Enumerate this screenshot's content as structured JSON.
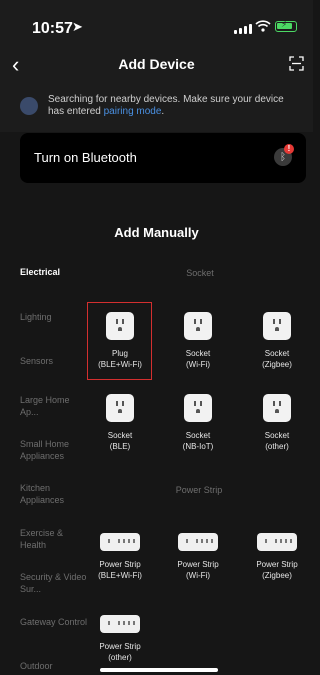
{
  "status_bar": {
    "time": "10:57",
    "location_icon": "location-arrow-icon",
    "signal_icon": "cellular-signal-icon",
    "wifi_icon": "wifi-icon",
    "battery_icon": "battery-charging-icon"
  },
  "nav": {
    "title": "Add Device",
    "back_icon": "chevron-left-icon",
    "scan_icon": "scan-icon"
  },
  "search": {
    "text_before": "Searching for nearby devices. Make sure your device has entered ",
    "link": "pairing mode",
    "text_after": "."
  },
  "bluetooth": {
    "label": "Turn on Bluetooth",
    "badge": "!"
  },
  "section_title": "Add Manually",
  "sidebar": {
    "items": [
      {
        "label": "Electrical",
        "active": true
      },
      {
        "label": "Lighting",
        "active": false
      },
      {
        "label": "Sensors",
        "active": false
      },
      {
        "label": "Large Home Ap...",
        "active": false
      },
      {
        "label": "Small Home Appliances",
        "active": false
      },
      {
        "label": "Kitchen Appliances",
        "active": false
      },
      {
        "label": "Exercise & Health",
        "active": false
      },
      {
        "label": "Security & Video Sur...",
        "active": false
      },
      {
        "label": "Gateway Control",
        "active": false
      },
      {
        "label": "Outdoor",
        "active": false
      }
    ]
  },
  "groups": [
    {
      "label": "Socket",
      "devices": [
        {
          "label1": "Plug",
          "label2": "(BLE+Wi-Fi)",
          "icon": "socket-icon",
          "selected": true
        },
        {
          "label1": "Socket",
          "label2": "(Wi-Fi)",
          "icon": "socket-icon"
        },
        {
          "label1": "Socket",
          "label2": "(Zigbee)",
          "icon": "socket-icon"
        },
        {
          "label1": "Socket",
          "label2": "(BLE)",
          "icon": "socket-icon"
        },
        {
          "label1": "Socket",
          "label2": "(NB-IoT)",
          "icon": "socket-icon"
        },
        {
          "label1": "Socket",
          "label2": "(other)",
          "icon": "socket-icon"
        }
      ]
    },
    {
      "label": "Power Strip",
      "devices": [
        {
          "label1": "Power Strip",
          "label2": "(BLE+Wi-Fi)",
          "icon": "power-strip-icon"
        },
        {
          "label1": "Power Strip",
          "label2": "(Wi-Fi)",
          "icon": "power-strip-icon"
        },
        {
          "label1": "Power Strip",
          "label2": "(Zigbee)",
          "icon": "power-strip-icon"
        },
        {
          "label1": "Power Strip",
          "label2": "(other)",
          "icon": "power-strip-icon"
        }
      ]
    }
  ],
  "colors": {
    "background": "#161616",
    "accent_link": "#4a90e2",
    "selection": "#d32f2f",
    "battery": "#4cd964"
  }
}
